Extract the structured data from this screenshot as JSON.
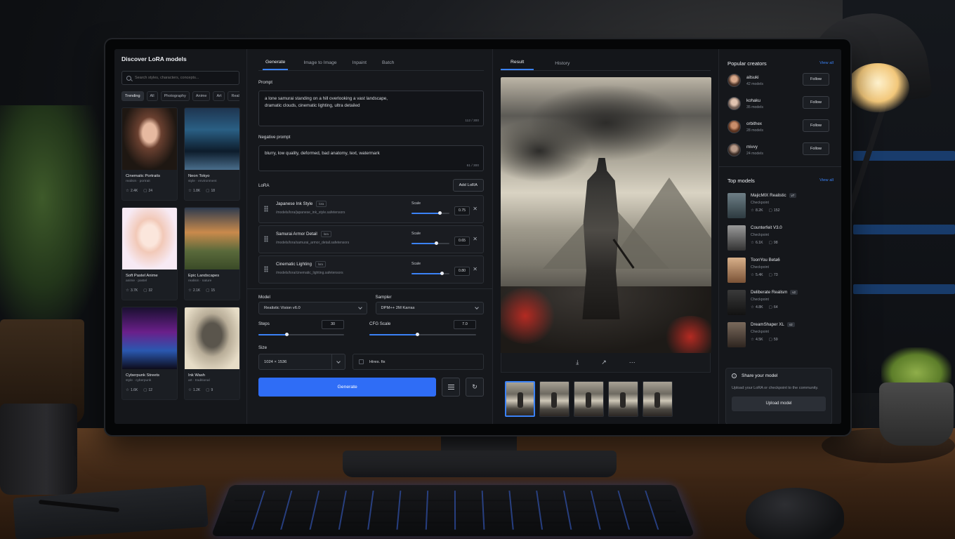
{
  "left": {
    "title": "Discover LoRA models",
    "search_placeholder": "Search styles, characters, concepts...",
    "chips": [
      "Trending",
      "All",
      "Photography",
      "Anime",
      "Art",
      "Real"
    ],
    "cards": [
      {
        "title": "Cinematic Portraits",
        "sub": "realism · portrait",
        "stars": "2.4K",
        "comments": "24"
      },
      {
        "title": "Neon Tokyo",
        "sub": "style · environment",
        "stars": "1.8K",
        "comments": "18"
      },
      {
        "title": "Soft Pastel Anime",
        "sub": "anime · pastel",
        "stars": "3.7K",
        "comments": "32"
      },
      {
        "title": "Epic Landscapes",
        "sub": "realism · nature",
        "stars": "2.1K",
        "comments": "15"
      },
      {
        "title": "Cyberpunk Streets",
        "sub": "style · cyberpunk",
        "stars": "1.6K",
        "comments": "12"
      },
      {
        "title": "Ink Wash",
        "sub": "art · traditional",
        "stars": "1.2K",
        "comments": "9"
      }
    ]
  },
  "mid": {
    "tabs": [
      "Generate",
      "Image to Image",
      "Inpaint",
      "Batch"
    ],
    "prompt_label": "Prompt",
    "prompt_text": "a lone samurai standing on a hill overlooking a vast landscape,\ndramatic clouds, cinematic lighting, ultra detailed",
    "prompt_count": "112 / 300",
    "neg_label": "Negative prompt",
    "neg_text": "blurry, low quality, deformed, bad anatomy, text, watermark",
    "neg_count": "61 / 300",
    "lora_label": "LoRA",
    "add_lora": "Add LoRA",
    "scale_label": "Scale",
    "loras": [
      {
        "name": "Japanese Ink Style",
        "tag": "lora",
        "path": "/models/lora/japanese_ink_style.safetensors",
        "scale": "0.75",
        "fill": 0.75
      },
      {
        "name": "Samurai Armor Detail",
        "tag": "lora",
        "path": "/models/lora/samurai_armor_detail.safetensors",
        "scale": "0.65",
        "fill": 0.65
      },
      {
        "name": "Cinematic Lighting",
        "tag": "lora",
        "path": "/models/lora/cinematic_lighting.safetensors",
        "scale": "0.80",
        "fill": 0.8
      }
    ],
    "model_label": "Model",
    "model_value": "Realistic Vision v6.0",
    "sampler_label": "Sampler",
    "sampler_value": "DPM++ 2M Karras",
    "steps_label": "Steps",
    "steps_value": "30",
    "steps_fill": 0.33,
    "cfg_label": "CFG Scale",
    "cfg_value": "7.0",
    "cfg_fill": 0.45,
    "size_label": "Size",
    "size_value": "1024 × 1536",
    "hires_label": "Hires. fix",
    "generate": "Generate"
  },
  "res": {
    "tabs": [
      "Result",
      "History"
    ]
  },
  "right": {
    "creators_title": "Popular creators",
    "view_all": "View all",
    "follow": "Follow",
    "creators": [
      {
        "name": "aitsuki",
        "sub": "42 models"
      },
      {
        "name": "kohaku",
        "sub": "35 models"
      },
      {
        "name": "orbithex",
        "sub": "28 models"
      },
      {
        "name": "mivvy",
        "sub": "24 models"
      }
    ],
    "models_title": "Top models",
    "models": [
      {
        "name": "MajicMIX Realistic",
        "ver": "v7",
        "sub": "Checkpoint",
        "stars": "8.2K",
        "comments": "152"
      },
      {
        "name": "Counterfeit V3.0",
        "ver": "",
        "sub": "Checkpoint",
        "stars": "6.1K",
        "comments": "98"
      },
      {
        "name": "ToonYou Beta6",
        "ver": "",
        "sub": "Checkpoint",
        "stars": "5.4K",
        "comments": "73"
      },
      {
        "name": "Deliberate Realism",
        "ver": "v2",
        "sub": "Checkpoint",
        "stars": "4.8K",
        "comments": "64"
      },
      {
        "name": "DreamShaper XL",
        "ver": "v2",
        "sub": "Checkpoint",
        "stars": "4.5K",
        "comments": "59"
      }
    ],
    "share_title": "Share your model",
    "share_text": "Upload your LoRA or checkpoint to the community.",
    "upload": "Upload model"
  }
}
